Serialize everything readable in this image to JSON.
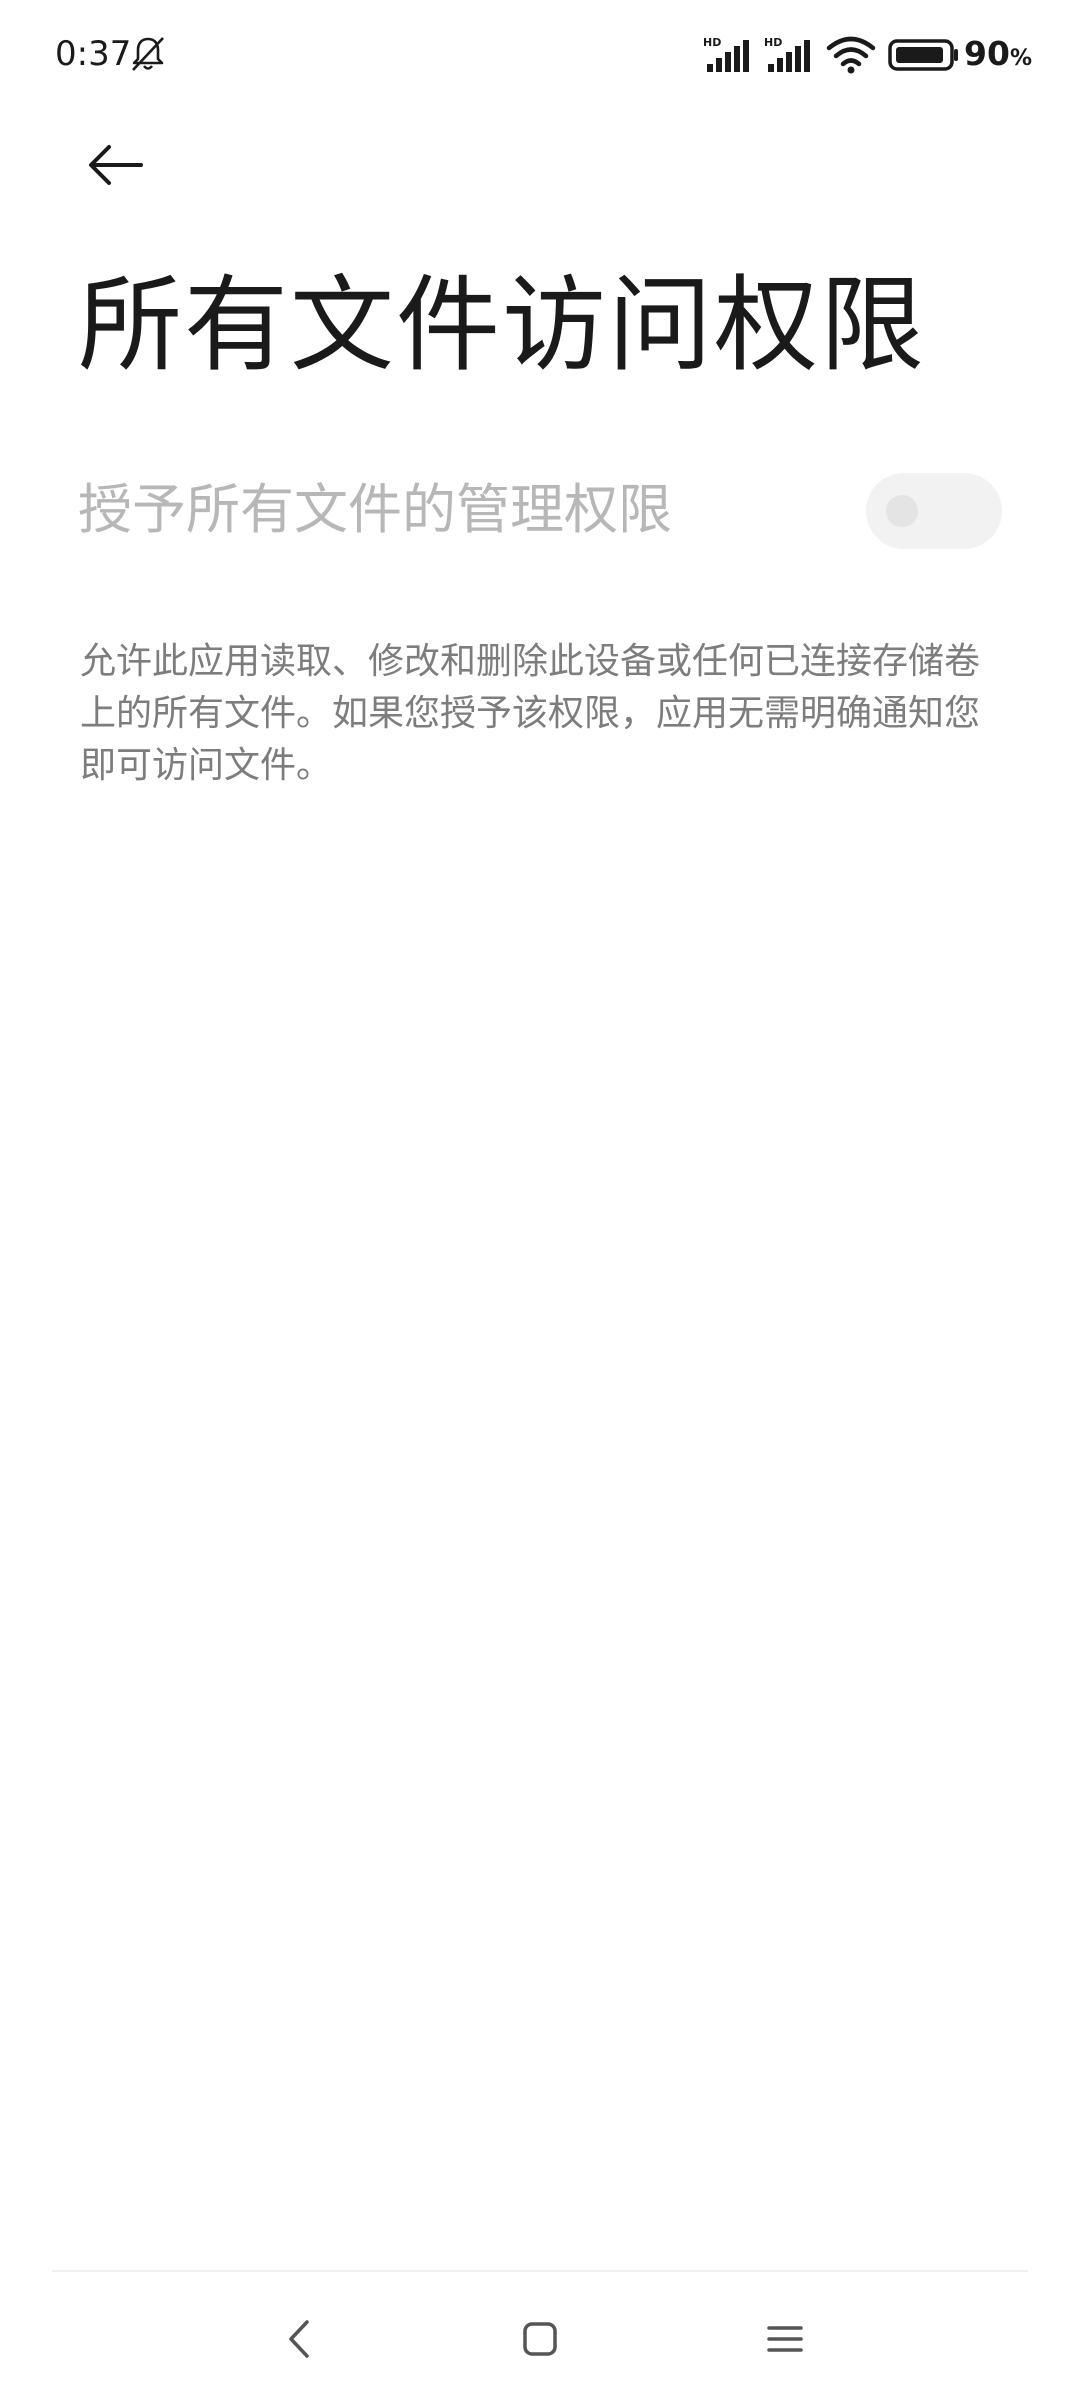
{
  "status_bar": {
    "time": "0:37",
    "battery_value": "90",
    "battery_unit": "%",
    "battery_level": 0.9,
    "icons": [
      "bell-off-icon",
      "signal-hd-icon",
      "signal-hd-icon",
      "wifi-icon",
      "battery-icon"
    ]
  },
  "header": {
    "back_icon": "arrow-left-icon",
    "title": "所有文件访问权限"
  },
  "setting": {
    "label": "授予所有文件的管理权限",
    "toggle_state": "off",
    "disabled": true
  },
  "description": "允许此应用读取、修改和删除此设备或任何已连接存储卷上的所有文件。如果您授予该权限，应用无需明确通知您即可访问文件。",
  "nav_bar": {
    "buttons": [
      "nav-back-icon",
      "nav-home-icon",
      "nav-recents-icon"
    ]
  },
  "colors": {
    "background": "#ffffff",
    "title": "#1a1a1a",
    "disabled_label": "#b7b7b7",
    "description": "#7d7d7d"
  }
}
